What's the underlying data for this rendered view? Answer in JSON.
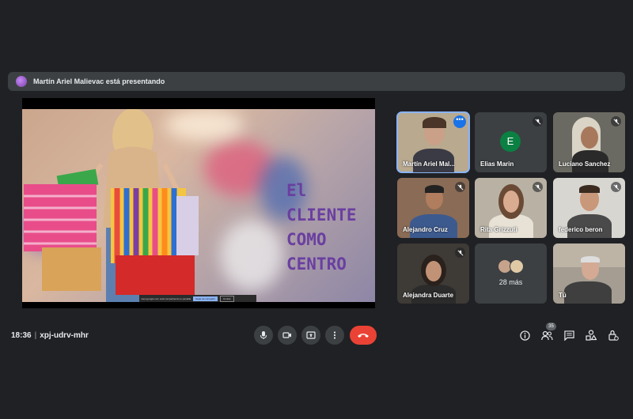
{
  "banner": {
    "text": "Martín Ariel Malievac está presentando"
  },
  "slide": {
    "title": "El\nCLIENTE\nCOMO\nCENTRO",
    "share_bar": {
      "text": "meet.google.com está compartiendo tu pantalla",
      "stop_label": "Dejar de compartir",
      "hide_label": "Ocultar"
    }
  },
  "participants": [
    {
      "name": "Martín Ariel Mal...",
      "type": "video",
      "selected": true
    },
    {
      "name": "Elias Marin",
      "type": "initial",
      "initial": "E",
      "muted": true
    },
    {
      "name": "Luciano Sanchez",
      "type": "video",
      "muted": true
    },
    {
      "name": "Alejandro Cruz",
      "type": "video",
      "muted": true
    },
    {
      "name": "Rita Grizzuti",
      "type": "video",
      "muted": true
    },
    {
      "name": "federico beron",
      "type": "video",
      "muted": true
    },
    {
      "name": "Alejandra Duarte",
      "type": "video",
      "muted": true
    },
    {
      "name": "",
      "type": "others",
      "count_label": "28 más"
    },
    {
      "name": "Tú",
      "type": "video"
    }
  ],
  "footer": {
    "time": "18:36",
    "separator": "|",
    "meeting_code": "xpj-udrv-mhr",
    "people_count": "35"
  },
  "colors": {
    "background": "#202124",
    "end_call": "#ea4335",
    "accent": "#8ab4f8"
  },
  "icons": [
    "mic-icon",
    "camera-icon",
    "present-icon",
    "more-vert-icon",
    "end-call-icon",
    "info-icon",
    "people-icon",
    "chat-icon",
    "activities-icon",
    "host-controls-icon"
  ]
}
